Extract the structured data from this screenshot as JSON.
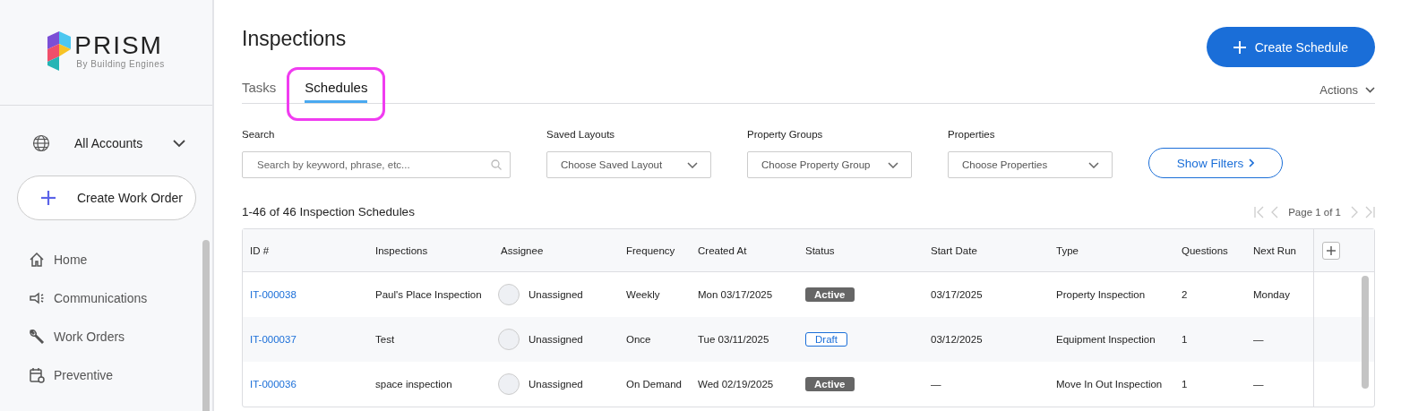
{
  "sidebar": {
    "logo": {
      "name": "PRISM",
      "tagline": "By Building Engines"
    },
    "account": {
      "label": "All Accounts"
    },
    "create_button": {
      "label": "Create Work Order"
    },
    "items": [
      {
        "label": "Home",
        "kind": "home"
      },
      {
        "label": "Communications",
        "kind": "megaphone"
      },
      {
        "label": "Work Orders",
        "kind": "wrench"
      },
      {
        "label": "Preventive",
        "kind": "calendar"
      }
    ]
  },
  "page": {
    "title": "Inspections",
    "primary_button": {
      "label": "Create Schedule"
    },
    "tabs": [
      {
        "label": "Tasks",
        "selected": false,
        "highlighted": false
      },
      {
        "label": "Schedules",
        "selected": true,
        "highlighted": true
      }
    ],
    "actions": {
      "label": "Actions"
    }
  },
  "filters": {
    "search": {
      "label": "Search",
      "placeholder": "Search by keyword, phrase, etc..."
    },
    "dropdowns": [
      {
        "label": "Saved Layouts",
        "placeholder": "Choose Saved Layout"
      },
      {
        "label": "Property Groups",
        "placeholder": "Choose Property Group"
      },
      {
        "label": "Properties",
        "placeholder": "Choose Properties"
      }
    ],
    "show_filters": {
      "label": "Show Filters"
    }
  },
  "table": {
    "count": "1-46 of 46 Inspection Schedules",
    "pagination": "Page 1 of 1",
    "columns": [
      "ID #",
      "Inspections",
      "Assignee",
      "Frequency",
      "Created At",
      "Status",
      "Start Date",
      "Type",
      "Questions",
      "Next Run"
    ],
    "rows": [
      {
        "id": "IT-000038",
        "inspection": "Paul's Place Inspection",
        "assignee": "Unassigned",
        "frequency": "Weekly",
        "created_at": "Mon 03/17/2025",
        "status": {
          "label": "Active",
          "kind": "active"
        },
        "start_date": "03/17/2025",
        "type": "Property Inspection",
        "questions": "2",
        "next_run": "Monday"
      },
      {
        "id": "IT-000037",
        "inspection": "Test",
        "assignee": "Unassigned",
        "frequency": "Once",
        "created_at": "Tue 03/11/2025",
        "status": {
          "label": "Draft",
          "kind": "draft"
        },
        "start_date": "03/12/2025",
        "type": "Equipment Inspection",
        "questions": "1",
        "next_run": "—"
      },
      {
        "id": "IT-000036",
        "inspection": "space inspection",
        "assignee": "Unassigned",
        "frequency": "On Demand",
        "created_at": "Wed 02/19/2025",
        "status": {
          "label": "Active",
          "kind": "active"
        },
        "start_date": "—",
        "type": "Move In Out Inspection",
        "questions": "1",
        "next_run": "—"
      }
    ]
  }
}
